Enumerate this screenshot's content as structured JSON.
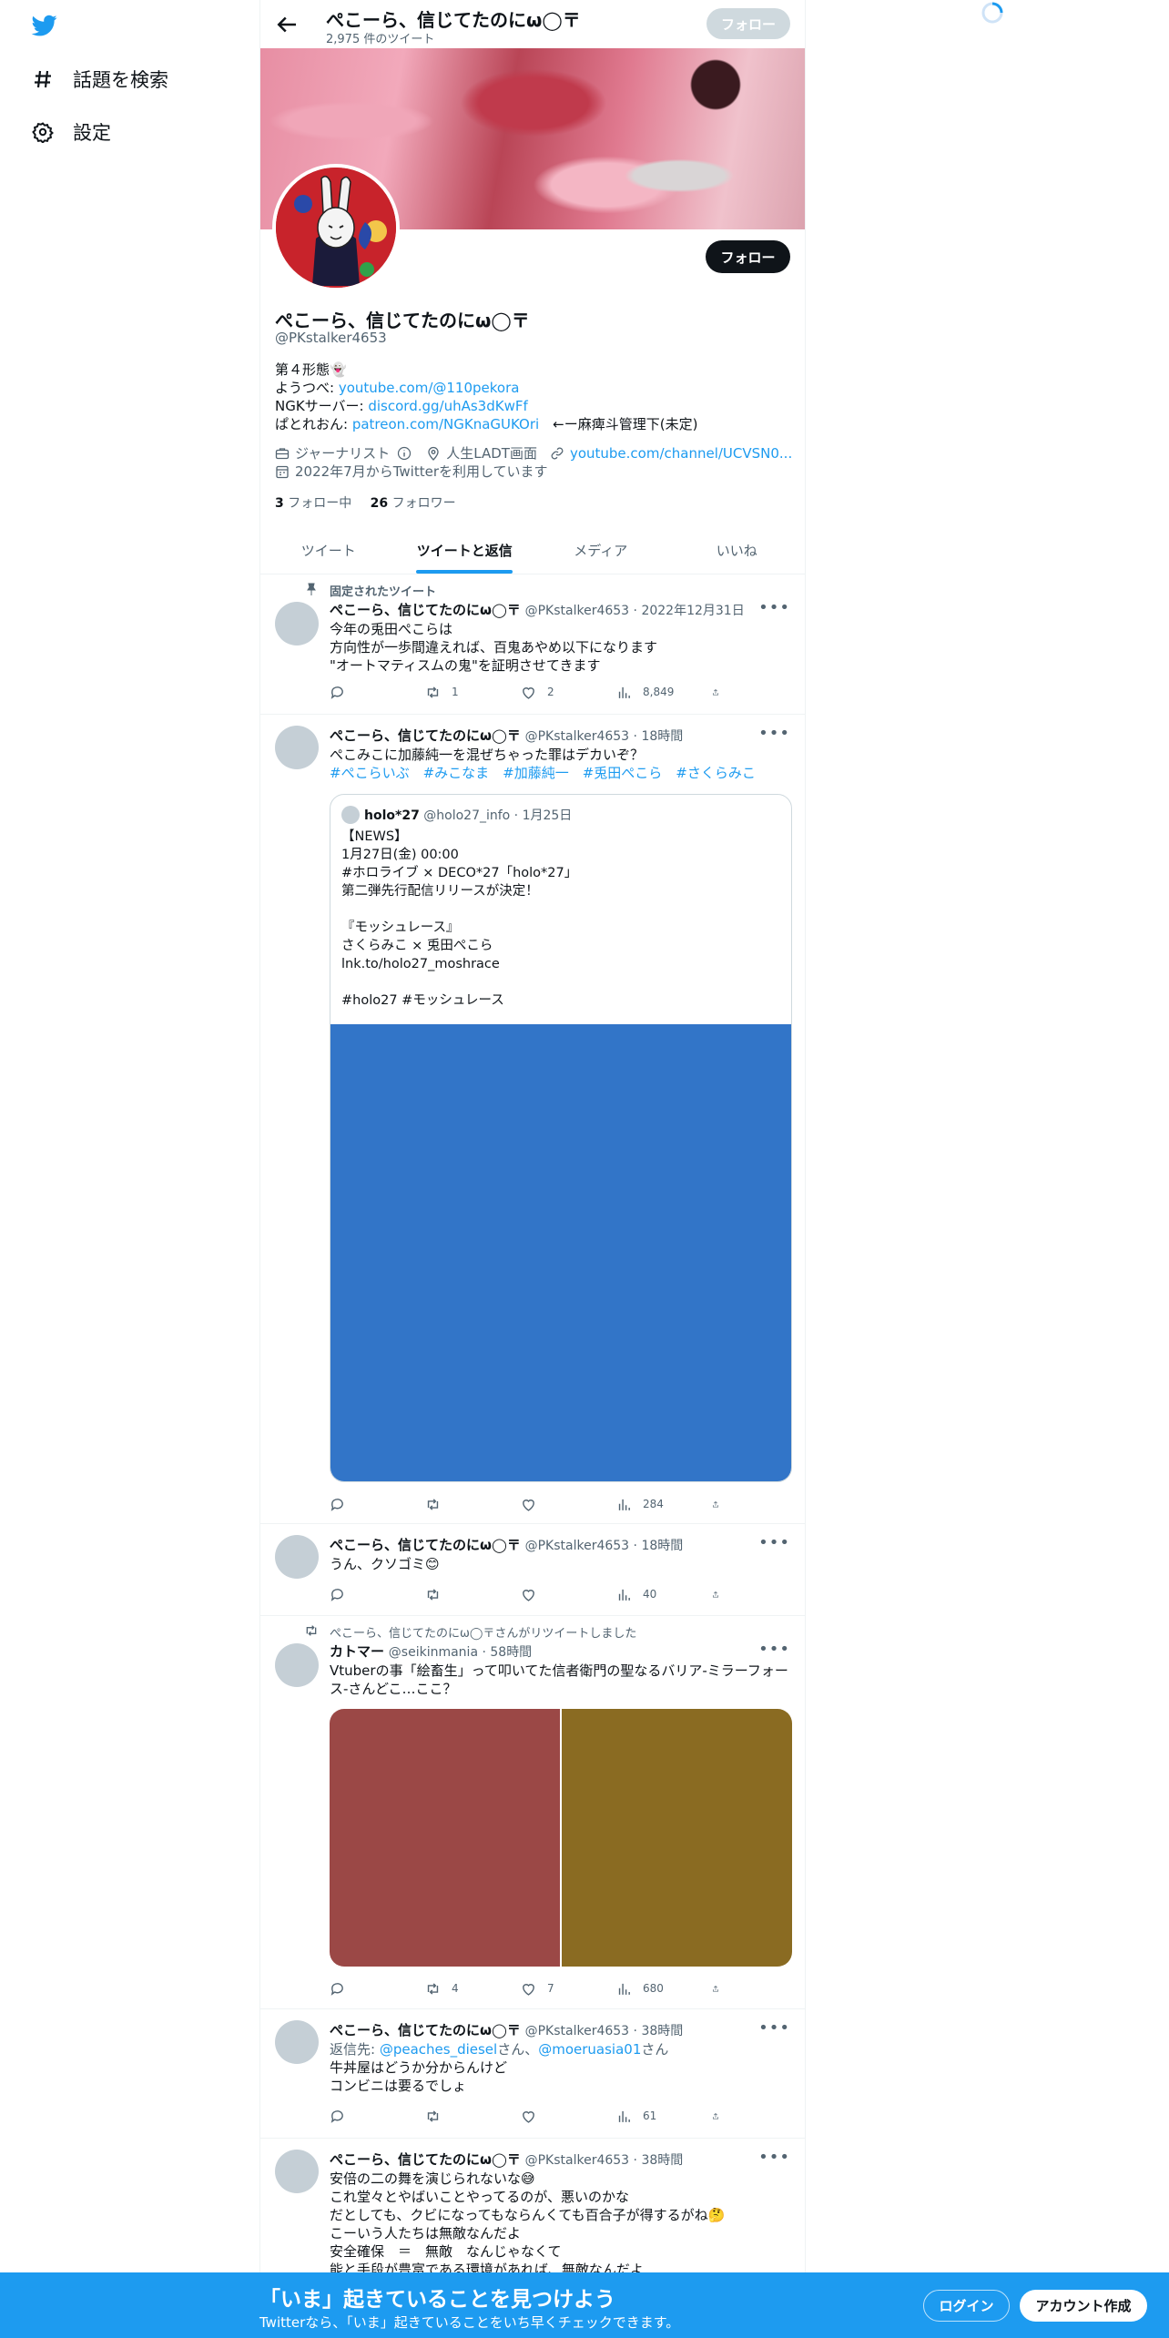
{
  "sidebar": {
    "items": [
      {
        "label": "話題を検索",
        "icon": "hashtag-icon"
      },
      {
        "label": "設定",
        "icon": "gear-icon"
      }
    ]
  },
  "header": {
    "name": "ぺこーら、信じてたのにω◯〒",
    "tweet_count": "2,975 件のツイート",
    "follow_label": "フォロー"
  },
  "profile": {
    "follow_label": "フォロー",
    "name": "ぺこーら、信じてたのにω◯〒",
    "handle": "@PKstalker4653",
    "bio": {
      "line1": "第４形態👻",
      "line2_label": "ようつべ: ",
      "line2_link": "youtube.com/@110pekora",
      "line3_label": "NGKサーバー: ",
      "line3_link": "discord.gg/uhAs3dKwFf",
      "line4_label": "ぱとれおん: ",
      "line4_link": "patreon.com/NGKnaGUKOri",
      "line4_suffix": "　←ー麻痺斗管理下(未定)"
    },
    "meta": {
      "category": "ジャーナリスト",
      "location": "人生LADT画面",
      "website": "youtube.com/channel/UCVSN0...",
      "joined": "2022年7月からTwitterを利用しています"
    },
    "following_count": "3",
    "following_label": " フォロー中",
    "followers_count": "26",
    "followers_label": " フォロワー"
  },
  "tabs": [
    {
      "label": "ツイート",
      "active": false
    },
    {
      "label": "ツイートと返信",
      "active": true
    },
    {
      "label": "メディア",
      "active": false
    },
    {
      "label": "いいね",
      "active": false
    }
  ],
  "tweets": [
    {
      "context": "固定されたツイート",
      "name": "ぺこーら、信じてたのにω◯〒",
      "meta": "@PKstalker4653 · 2022年12月31日",
      "lines": [
        "今年の兎田ぺこらは",
        "方向性が一歩間違えれば、百鬼あやめ以下になります",
        "\"オートマティスムの鬼\"を証明させてきます"
      ],
      "stats": {
        "reply": "",
        "retweet": "1",
        "like": "2",
        "views": "8,849"
      }
    },
    {
      "name": "ぺこーら、信じてたのにω◯〒",
      "meta": "@PKstalker4653 · 18時間",
      "lines": [
        "ぺこみこに加藤純一を混ぜちゃった罪はデカいぞ？"
      ],
      "hashtags": "#ぺこらいぶ　#みこなま　#加藤純一　#兎田ぺこら　#さくらみこ",
      "quote": {
        "name": "holo*27",
        "meta": "@holo27_info · 1月25日",
        "lines": [
          "【NEWS】",
          "1月27日(金) 00:00",
          "#ホロライブ × DECO*27「holo*27」",
          "第二弾先行配信リリースが決定！",
          "",
          "『モッシュレース』",
          "さくらみこ × 兎田ぺこら",
          "lnk.to/holo27_moshrace",
          "",
          "#holo27 #モッシュレース"
        ],
        "media_color": "#3275c8"
      },
      "stats": {
        "reply": "",
        "retweet": "",
        "like": "",
        "views": "284"
      }
    },
    {
      "name": "ぺこーら、信じてたのにω◯〒",
      "meta": "@PKstalker4653 · 18時間",
      "lines": [
        "うん、クソゴミ😊"
      ],
      "stats": {
        "reply": "",
        "retweet": "",
        "like": "",
        "views": "40"
      }
    },
    {
      "context": "ぺこーら、信じてたのにω◯〒さんがリツイートしました",
      "name": "カトマー",
      "meta": "@seikinmania · 58時間",
      "lines": [
        "Vtuberの事「絵畜生」って叩いてた信者衛門の聖なるバリア-ミラーフォー",
        "ス-さんどこ…ここ？"
      ],
      "media_colors": [
        "#9b4846",
        "#8a6b22"
      ],
      "stats": {
        "reply": "",
        "retweet": "4",
        "like": "7",
        "views": "680"
      }
    },
    {
      "name": "ぺこーら、信じてたのにω◯〒",
      "meta": "@PKstalker4653 · 38時間",
      "reply_prefix": "返信先: ",
      "reply_to1": "@peaches_diesel",
      "reply_mid": "さん、",
      "reply_to2": "@moeruasia01",
      "reply_suffix": "さん",
      "lines": [
        "牛丼屋はどうか分からんけど",
        "コンビニは要るでしょ"
      ],
      "stats": {
        "reply": "",
        "retweet": "",
        "like": "",
        "views": "61"
      }
    },
    {
      "name": "ぺこーら、信じてたのにω◯〒",
      "meta": "@PKstalker4653 · 38時間",
      "lines": [
        "安倍の二の舞を演じられないな😅",
        "これ堂々とやばいことやってるのが、悪いのかな",
        "だとしても、クビになってもならんくても百合子が得するがね🤔",
        "こーいう人たちは無敵なんだよ",
        "安全確保　＝　無敵　なんじゃなくて",
        "能と手段が豊富である環境があれば、無敵なんだよ"
      ]
    }
  ],
  "bottom_bar": {
    "title": "「いま」起きていることを見つけよう",
    "subtitle": "Twitterなら、「いま」起きていることをいち早くチェックできます。",
    "login_label": "ログイン",
    "signup_label": "アカウント作成"
  }
}
